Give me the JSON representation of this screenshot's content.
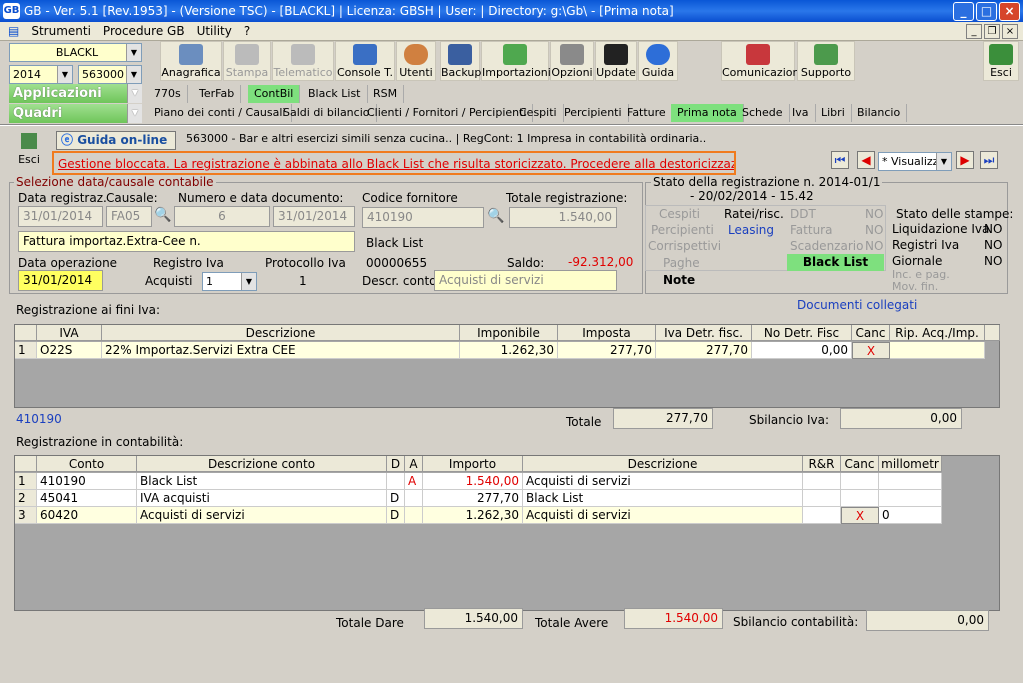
{
  "window": {
    "title": "GB - Ver. 5.1 [Rev.1953] - (Versione TSC) -                                              [BLACKL]  | Licenza: GBSH | User:                  | Directory: g:\\Gb\\ - [Prima nota]",
    "logo": "GB",
    "min": "_",
    "max": "□",
    "close": "×"
  },
  "menu": {
    "items": [
      "Strumenti",
      "Procedure GB",
      "Utility",
      "?"
    ],
    "mdi_min": "_",
    "mdi_restore": "❐",
    "mdi_close": "×"
  },
  "left": {
    "company": "BLACKL",
    "year": "2014",
    "activity": "563000 -",
    "applicazioni": "Applicazioni",
    "quadri": "Quadri"
  },
  "toolbar": {
    "items": [
      "Anagrafica",
      "Stampa",
      "Telematico",
      "Console T.",
      "Utenti",
      "Backup",
      "Importazioni",
      "Opzioni",
      "Update",
      "Guida",
      "Comunicazioni",
      "Supporto",
      "Esci"
    ]
  },
  "tabs1": [
    "770s",
    "TerFab",
    "ContBil",
    "Black List",
    "RSM"
  ],
  "tabs2": [
    "Piano dei conti / Causali",
    "Saldi di bilancio",
    "Clienti / Fornitori / Percipienti",
    "Cespiti",
    "Percipienti",
    "Fatture",
    "Prima nota",
    "Schede",
    "Iva",
    "Libri",
    "Bilancio"
  ],
  "form": {
    "exit_label": "Esci",
    "guide": "Guida on-line",
    "info": "563000 - Bar e altri esercizi simili senza cucina..  | RegCont: 1 Impresa  in contabilità ordinaria..",
    "warning": "Gestione bloccata. La registrazione è abbinata allo Black List che risulta storicizzato. Procedere alla destoricizzazione.",
    "view_mode": "* Visualizz",
    "nav": {
      "first": "⏮",
      "prev": "◀",
      "next": "▶",
      "last": "⏭"
    },
    "selection_title": "Selezione data/causale contabile",
    "labels": {
      "data_reg": "Data registraz.",
      "causale": "Causale:",
      "numero_data": "Numero e data documento:",
      "codice_fornitore": "Codice fornitore",
      "totale_reg": "Totale registrazione:",
      "data_op": "Data operazione",
      "registro_iva": "Registro Iva",
      "protocollo": "Protocollo Iva",
      "saldo": "Saldo:",
      "descr_conto": "Descr. conto"
    },
    "data_reg": "31/01/2014",
    "causale": "FA05",
    "numero": "6",
    "data_doc": "31/01/2014",
    "descrizione": "Fattura importaz.Extra-Cee n.",
    "codice_fornitore": "410190",
    "totale": "1.540,00",
    "fornitore_name": "Black List",
    "fornitore_code": "00000655",
    "saldo": "-92.312,00",
    "descr_conto": "Acquisti di servizi",
    "data_op": "31/01/2014",
    "registro_label": "Acquisti",
    "registro_num": "1",
    "protocollo": "1"
  },
  "stato": {
    "title": "Stato della registrazione n. 2014-01/1",
    "date": "- 20/02/2014 - 15.42",
    "cells": {
      "cespiti": "Cespiti",
      "ratei": "Ratei/risc.",
      "ddt": "DDT",
      "ddt_no": "NO",
      "percipienti": "Percipienti",
      "leasing": "Leasing",
      "fattura": "Fattura",
      "fattura_no": "NO",
      "corrispettivi": "Corrispettivi",
      "scadenzario": "Scadenzario",
      "scad_no": "NO",
      "paghe": "Paghe",
      "blacklist": "Black List",
      "note": "Note"
    },
    "stampe_title": "Stato delle stampe:",
    "stampe": [
      {
        "label": "Liquidazione Iva",
        "val": "NO"
      },
      {
        "label": "Registri Iva",
        "val": "NO"
      },
      {
        "label": "Giornale",
        "val": "NO"
      },
      {
        "label": "Inc. e pag.",
        "val": ""
      },
      {
        "label": "Mov. fin.",
        "val": ""
      }
    ],
    "documenti": "Documenti collegati"
  },
  "iva": {
    "title": "Registrazione ai fini Iva:",
    "headers": [
      "IVA",
      "Descrizione",
      "Imponibile",
      "Imposta",
      "Iva Detr. fisc.",
      "No Detr. Fisc",
      "Canc",
      "Rip. Acq./Imp."
    ],
    "rows": [
      {
        "n": "1",
        "code": "O22S",
        "desc": "22% Importaz.Servizi Extra CEE",
        "imponibile": "1.262,30",
        "imposta": "277,70",
        "detr": "277,70",
        "nodetr": "0,00",
        "canc": "X"
      }
    ],
    "account": "410190",
    "totale_label": "Totale",
    "totale": "277,70",
    "sbil_label": "Sbilancio Iva:",
    "sbil": "0,00"
  },
  "cont": {
    "title": "Registrazione in contabilità:",
    "headers": [
      "Conto",
      "Descrizione conto",
      "D",
      "A",
      "Importo",
      "Descrizione",
      "R&R",
      "Canc",
      "millometr"
    ],
    "rows": [
      {
        "n": "1",
        "conto": "410190",
        "desc": "Black List",
        "d": "",
        "a": "A",
        "importo": "1.540,00",
        "descr": "Acquisti di servizi",
        "canc": "",
        "mill": ""
      },
      {
        "n": "2",
        "conto": "45041",
        "desc": "IVA acquisti",
        "d": "D",
        "a": "",
        "importo": "277,70",
        "descr": "Black List",
        "canc": "",
        "mill": ""
      },
      {
        "n": "3",
        "conto": "60420",
        "desc": "Acquisti di servizi",
        "d": "D",
        "a": "",
        "importo": "1.262,30",
        "descr": "Acquisti di servizi",
        "canc": "X",
        "mill": "0"
      }
    ],
    "dare_label": "Totale Dare",
    "dare": "1.540,00",
    "avere_label": "Totale Avere",
    "avere": "1.540,00",
    "sbil_label": "Sbilancio contabilità:",
    "sbil": "0,00"
  }
}
